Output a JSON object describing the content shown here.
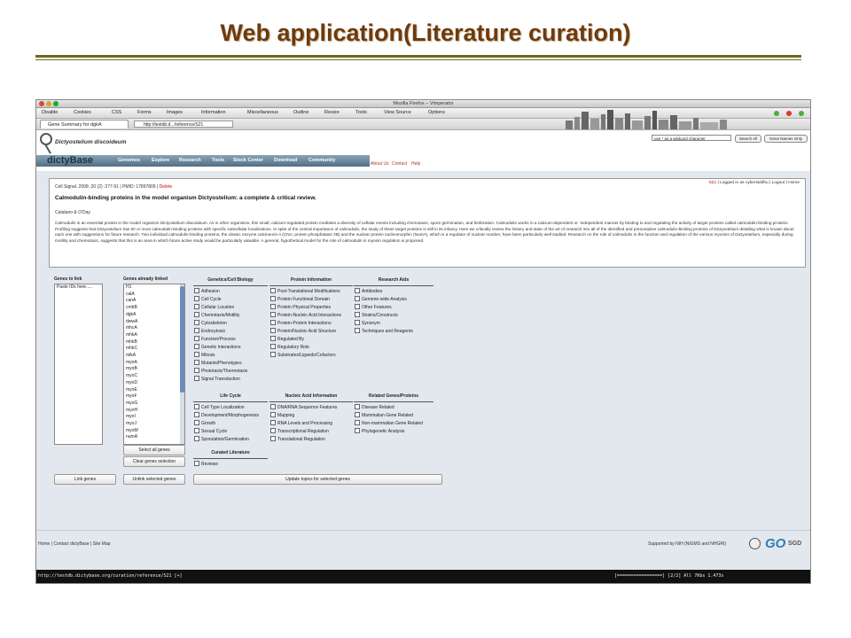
{
  "slide": {
    "title": "Web application(Literature curation)"
  },
  "browser": {
    "window_title": "Mozilla Firefox – Vimperator",
    "toolbar": [
      "Disable",
      "Cookies",
      "CSS",
      "Forms",
      "Images",
      "Information",
      "Miscellaneous",
      "Outline",
      "Resize",
      "Tools",
      "View Source",
      "Options"
    ],
    "tab_label": "Gene Summary for dgkA",
    "url": "http://testdb.d.../reference/S21",
    "status_url": "http://testdb.dictybase.org/curation/reference/S21 [+]",
    "status_right": "[=================] [2/2] All  7Kbs  1.473s"
  },
  "site": {
    "organism": "Dictyostelium discoideum",
    "brand": "dictyBase",
    "search_placeholder": "use * as a wildcard character",
    "search_all_label": "Search All",
    "gene_names_label": "Gene Names Only",
    "nav": [
      "Genomes",
      "Explore",
      "Research",
      "Tools",
      "Stock Center",
      "Download",
      "Community"
    ],
    "sub_links": [
      "About Us",
      "Contact",
      "Help"
    ]
  },
  "paper": {
    "citation": "Cell Signal. 2008 ;20 (2) :277-91 | PMID: 17897809 | ",
    "delete_label": "Delete",
    "ref_id": "S21",
    "login_text": " | Logged in as cybersiddhu | Logout | Home",
    "title": "Calmodulin-binding proteins in the model organism Dictyostelium: a complete & critical review.",
    "authors": "Catalano & O'Day",
    "abstract": "Calmodulin is an essential protein in the model organism Dictyostelium discoideum. As in other organisms, this small, calcium-regulated protein mediates a diversity of cellular events including chemotaxis, spore germination, and fertilization. Calmodulin works in a calcium-dependent or -independent manner by binding to and regulating the activity of target proteins called calmodulin-binding proteins. Profiling suggests that Dictyostelium has 60 or more calmodulin-binding proteins with specific subcellular localizations. In spite of the central importance of calmodulin, the study of these target proteins is still in its infancy. Here we critically review the history and state of the art of research into all of the identified and presumptive calmodulin-binding proteins of Dictyostelium detailing what is known about each one with suggestions for future research. Two individual calmodulin-binding proteins, the classic enzyme calcineurin A (CNA; protein phosphatase 2B) and the nuclear protein nucleomorphin (NumA), which is a regulator of nuclear number, have been particularly well studied. Research on the role of calmodulin in the function and regulation of the various myosins of Dictyostelium, especially during motility and chemotaxis, suggests that this is an area in which future active study would be particularly valuable. A general, hypothetical model for the role of calmodulin in myosin regulation is proposed."
  },
  "curation": {
    "genes_to_link_label": "Genes to link",
    "genes_to_link_value": "Paste IDs here.....",
    "genes_linked_label": "Genes already linked",
    "genes_linked": [
      "H1",
      "calA",
      "canA",
      "cmbB",
      "dgkA",
      "dwwA",
      "mhcA",
      "mhkA",
      "mhkB",
      "mhkC",
      "mlkA",
      "myoA",
      "myoB",
      "myoC",
      "myoD",
      "myoE",
      "myoF",
      "myoG",
      "myoH",
      "myoI",
      "myoJ",
      "myoM",
      "numA"
    ],
    "groups": [
      {
        "heading": "Genetics/Cell Biology",
        "options": [
          "Adhesion",
          "Cell Cycle",
          "Cellular Location",
          "Chemotaxis/Motility",
          "Cytoskeleton",
          "Endocytosis",
          "Function/Process",
          "Genetic Interactions",
          "Mitosis",
          "Mutants/Phenotypes",
          "Phototaxis/Thermotaxis",
          "Signal Transduction"
        ]
      },
      {
        "heading": "Protein Information",
        "options": [
          "Post-Translational Modifications",
          "Protein Functional Domain",
          "Protein Physical Properties",
          "Protein-Nucleic Acid Interactions",
          "Protein-Protein Interactions",
          "Protein/Nucleic Acid Structure",
          "Regulated By",
          "Regulatory Role",
          "Substrates/Ligands/Cofactors"
        ]
      },
      {
        "heading": "Research Aids",
        "options": [
          "Antibodies",
          "Genome-wide Analysis",
          "Other Features",
          "Strains/Constructs",
          "Synonym",
          "Techniques and Reagents"
        ]
      },
      {
        "heading": "Life Cycle",
        "options": [
          "Cell Type Localization",
          "Development/Morphogenesis",
          "Growth",
          "Sexual Cycle",
          "Sporulation/Germination"
        ]
      },
      {
        "heading": "Nucleic Acid Information",
        "options": [
          "DNA/RNA Sequence Features",
          "Mapping",
          "RNA Levels and Processing",
          "Transcriptional Regulation",
          "Translational Regulation"
        ]
      },
      {
        "heading": "Related Genes/Proteins",
        "options": [
          "Disease Related",
          "Mammalian Gene Related",
          "Non-mammalian Gene Related",
          "Phylogenetic Analysis"
        ]
      },
      {
        "heading": "Curated Literature",
        "options": [
          "Reviews"
        ]
      }
    ],
    "buttons": {
      "select_all": "Select all genes",
      "clear_selection": "Clear genes selection",
      "link_genes": "Link genes",
      "unlink_selected": "Unlink selected genes",
      "update_topics": "Update topics for selected genes"
    }
  },
  "footer": {
    "left": "Home | Contact dictyBase | Site Map",
    "right": "Supported by NIH (NIGMS and NHGRI)",
    "go_logo": "GO",
    "sgd_logo": "SGD"
  },
  "colors": {
    "title": "#6e3a0e",
    "rule": "#6f6a1e",
    "nav": "#5d7b91",
    "content_bg": "#e2e8ee"
  }
}
